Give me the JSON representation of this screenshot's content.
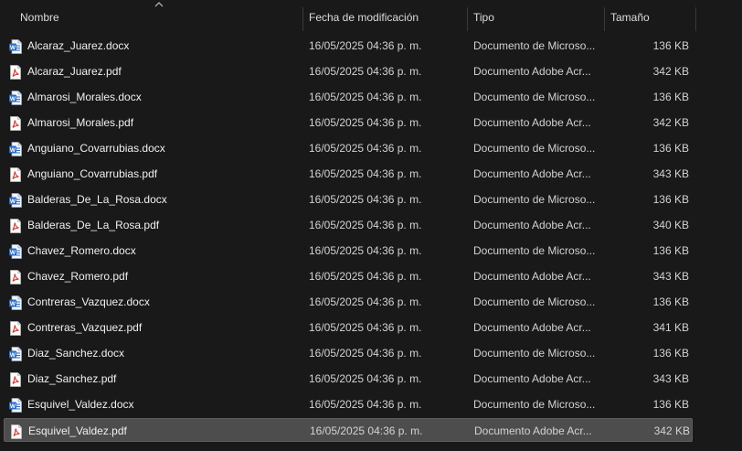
{
  "columns": {
    "name": "Nombre",
    "date": "Fecha de modificación",
    "type": "Tipo",
    "size": "Tamaño"
  },
  "icons": {
    "docx": "word-document-icon",
    "pdf": "pdf-document-icon",
    "sort": "sort-ascending-icon"
  },
  "colors": {
    "word_blue": "#2b6cc4",
    "pdf_red": "#d9342b",
    "selection": "#4d4d4d"
  },
  "files": [
    {
      "name": "Alcaraz_Juarez.docx",
      "date": "16/05/2025 04:36 p. m.",
      "type": "Documento de Microso...",
      "size": "136 KB",
      "kind": "docx"
    },
    {
      "name": "Alcaraz_Juarez.pdf",
      "date": "16/05/2025 04:36 p. m.",
      "type": "Documento Adobe Acr...",
      "size": "342 KB",
      "kind": "pdf"
    },
    {
      "name": "Almarosi_Morales.docx",
      "date": "16/05/2025 04:36 p. m.",
      "type": "Documento de Microso...",
      "size": "136 KB",
      "kind": "docx"
    },
    {
      "name": "Almarosi_Morales.pdf",
      "date": "16/05/2025 04:36 p. m.",
      "type": "Documento Adobe Acr...",
      "size": "342 KB",
      "kind": "pdf"
    },
    {
      "name": "Anguiano_Covarrubias.docx",
      "date": "16/05/2025 04:36 p. m.",
      "type": "Documento de Microso...",
      "size": "136 KB",
      "kind": "docx"
    },
    {
      "name": "Anguiano_Covarrubias.pdf",
      "date": "16/05/2025 04:36 p. m.",
      "type": "Documento Adobe Acr...",
      "size": "343 KB",
      "kind": "pdf"
    },
    {
      "name": "Balderas_De_La_Rosa.docx",
      "date": "16/05/2025 04:36 p. m.",
      "type": "Documento de Microso...",
      "size": "136 KB",
      "kind": "docx"
    },
    {
      "name": "Balderas_De_La_Rosa.pdf",
      "date": "16/05/2025 04:36 p. m.",
      "type": "Documento Adobe Acr...",
      "size": "340 KB",
      "kind": "pdf"
    },
    {
      "name": "Chavez_Romero.docx",
      "date": "16/05/2025 04:36 p. m.",
      "type": "Documento de Microso...",
      "size": "136 KB",
      "kind": "docx"
    },
    {
      "name": "Chavez_Romero.pdf",
      "date": "16/05/2025 04:36 p. m.",
      "type": "Documento Adobe Acr...",
      "size": "343 KB",
      "kind": "pdf"
    },
    {
      "name": "Contreras_Vazquez.docx",
      "date": "16/05/2025 04:36 p. m.",
      "type": "Documento de Microso...",
      "size": "136 KB",
      "kind": "docx"
    },
    {
      "name": "Contreras_Vazquez.pdf",
      "date": "16/05/2025 04:36 p. m.",
      "type": "Documento Adobe Acr...",
      "size": "341 KB",
      "kind": "pdf"
    },
    {
      "name": "Diaz_Sanchez.docx",
      "date": "16/05/2025 04:36 p. m.",
      "type": "Documento de Microso...",
      "size": "136 KB",
      "kind": "docx"
    },
    {
      "name": "Diaz_Sanchez.pdf",
      "date": "16/05/2025 04:36 p. m.",
      "type": "Documento Adobe Acr...",
      "size": "343 KB",
      "kind": "pdf"
    },
    {
      "name": "Esquivel_Valdez.docx",
      "date": "16/05/2025 04:36 p. m.",
      "type": "Documento de Microso...",
      "size": "136 KB",
      "kind": "docx"
    },
    {
      "name": "Esquivel_Valdez.pdf",
      "date": "16/05/2025 04:36 p. m.",
      "type": "Documento Adobe Acr...",
      "size": "342 KB",
      "kind": "pdf",
      "selected": true
    }
  ]
}
